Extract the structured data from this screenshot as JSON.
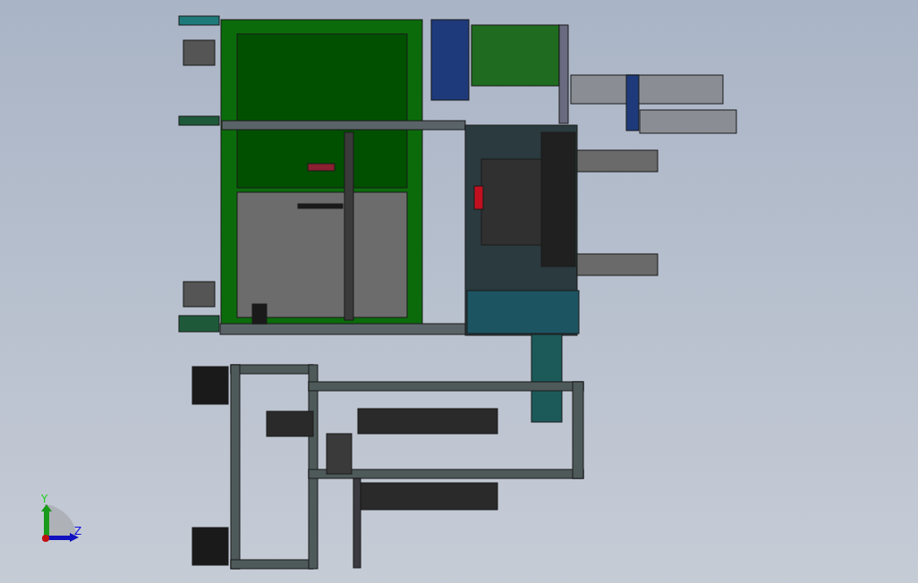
{
  "viewport": {
    "axis_triad": {
      "labels": [
        {
          "kind": "y",
          "text": "Y"
        },
        {
          "kind": "z",
          "text": "Z"
        }
      ]
    }
  }
}
